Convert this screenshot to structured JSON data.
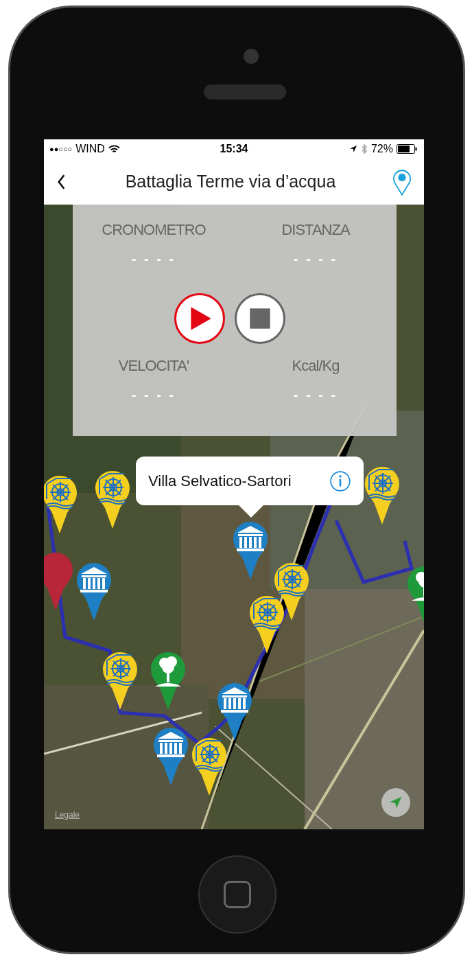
{
  "status_bar": {
    "signal": "●●○○○",
    "carrier": "WIND",
    "time": "15:34",
    "battery": "72%"
  },
  "nav": {
    "title": "Battaglia Terme via d’acqua"
  },
  "tracker": {
    "stats": [
      {
        "label": "CRONOMETRO",
        "value": "- - - -"
      },
      {
        "label": "DISTANZA",
        "value": "- - - -"
      },
      {
        "label": "VELOCITA'",
        "value": "- - - -"
      },
      {
        "label": "Kcal/Kg",
        "value": "- - - -"
      }
    ]
  },
  "callout": {
    "title": "Villa Selvatico-Sartori"
  },
  "pins": [
    {
      "kind": "other"
    },
    {
      "kind": "waterway"
    },
    {
      "kind": "waterway"
    },
    {
      "kind": "villa"
    },
    {
      "kind": "villa"
    },
    {
      "kind": "waterway"
    },
    {
      "kind": "waterway"
    },
    {
      "kind": "waterway"
    },
    {
      "kind": "nature"
    },
    {
      "kind": "villa"
    },
    {
      "kind": "villa"
    },
    {
      "kind": "waterway"
    },
    {
      "kind": "waterway"
    },
    {
      "kind": "nature"
    }
  ],
  "map": {
    "legal": "Legale"
  }
}
